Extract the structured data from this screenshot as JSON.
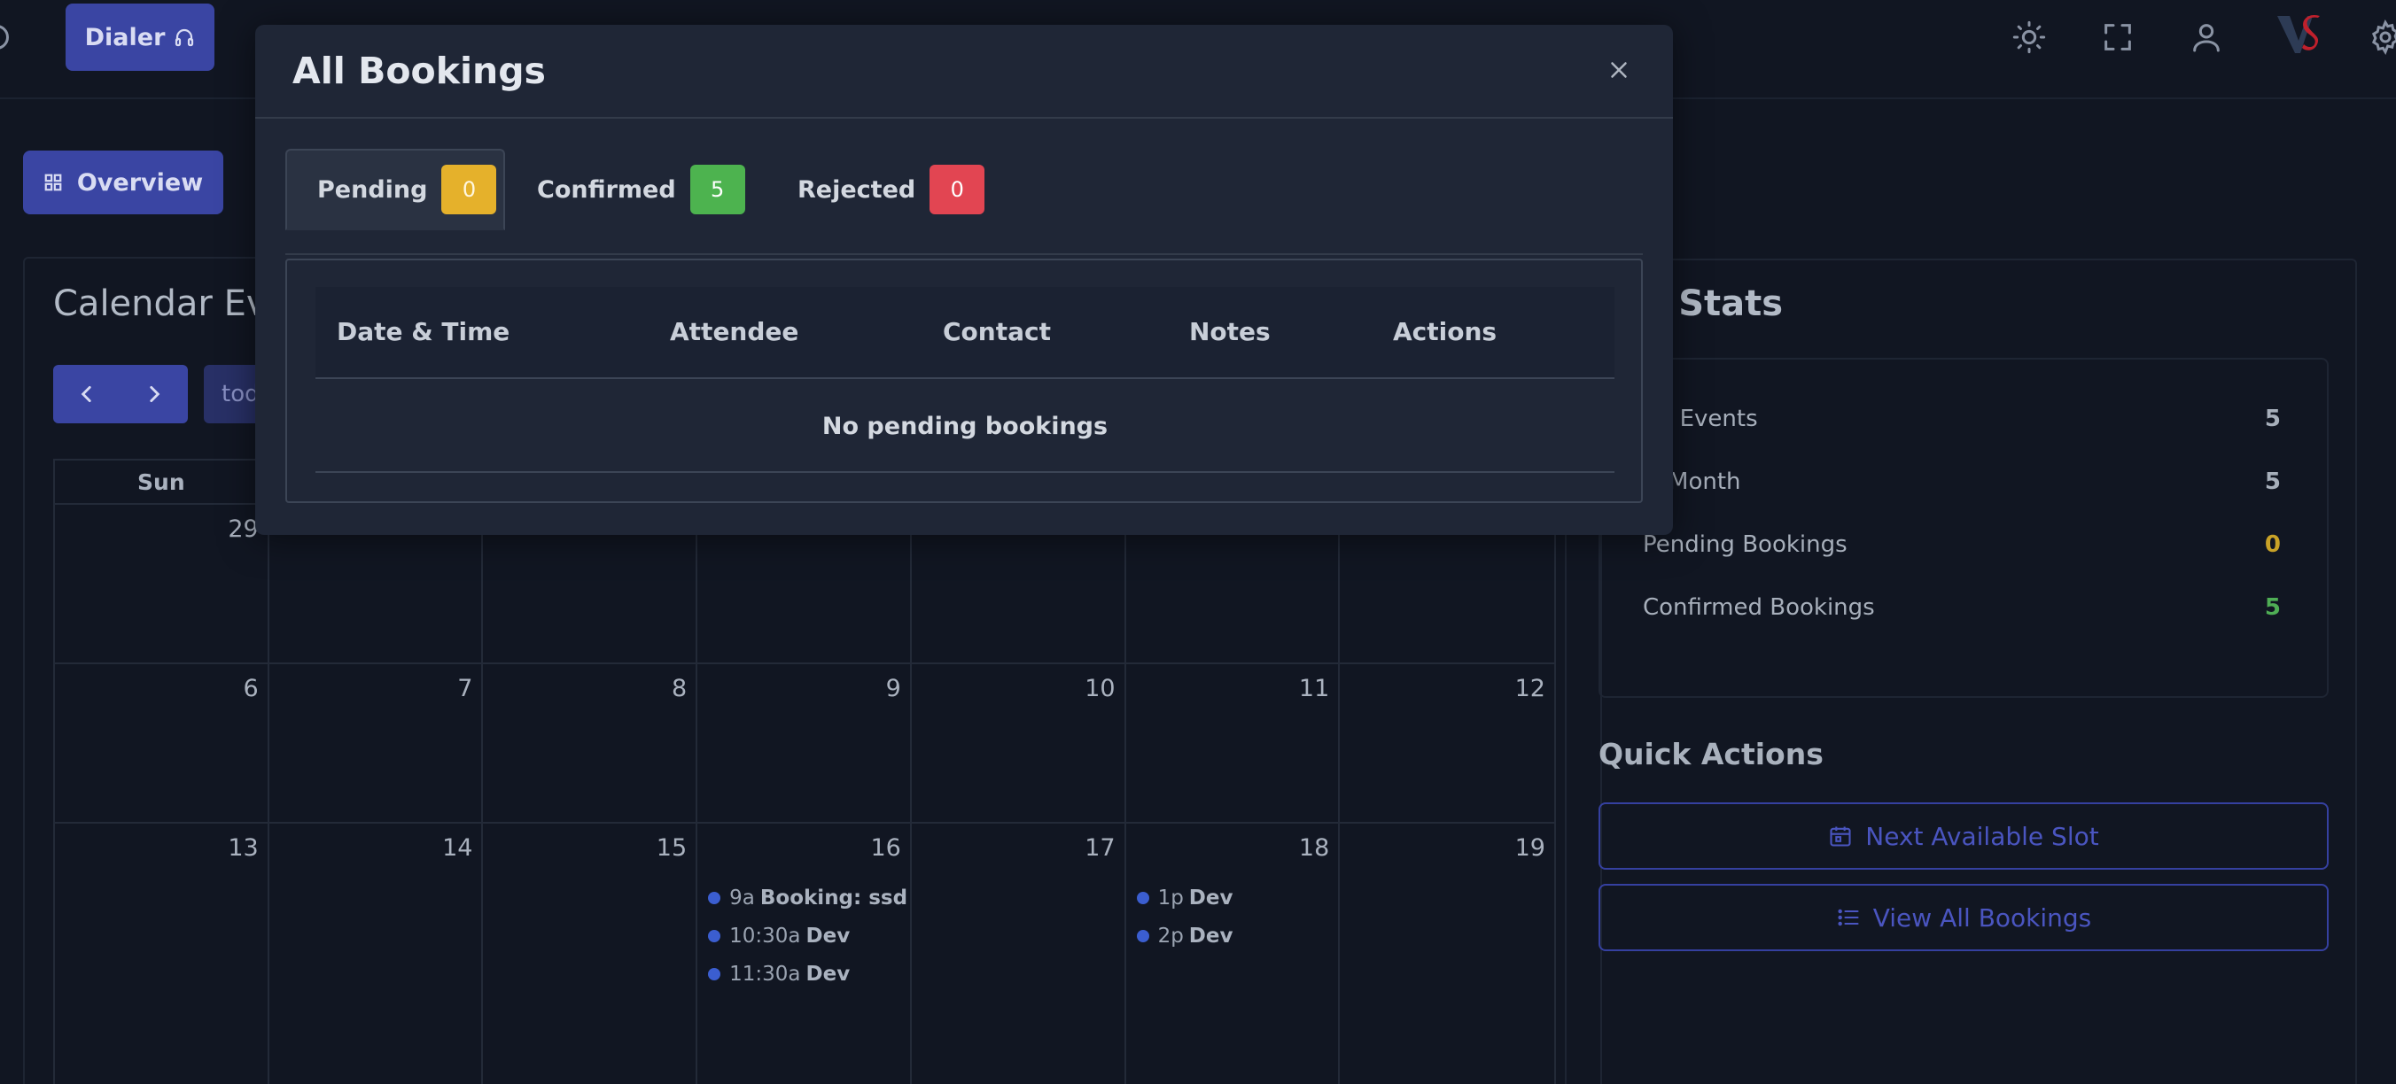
{
  "topbar": {
    "dialer_label": "Dialer",
    "icons": [
      "sun-icon",
      "fullscreen-icon",
      "user-icon",
      "brand-logo",
      "gear-icon"
    ]
  },
  "overview": {
    "label": "Overview"
  },
  "calendar": {
    "title": "Calendar Ev",
    "today_label": "tod",
    "weekday_visible": "Sun",
    "weeks": [
      [
        "29",
        "",
        "",
        "",
        "",
        "",
        ""
      ],
      [
        "6",
        "7",
        "8",
        "9",
        "10",
        "11",
        "12"
      ],
      [
        "13",
        "14",
        "15",
        "16",
        "17",
        "18",
        "19"
      ]
    ],
    "events": {
      "wed": [
        {
          "time": "9a",
          "title": "Booking: ssd"
        },
        {
          "time": "10:30a",
          "title": "Dev"
        },
        {
          "time": "11:30a",
          "title": "Dev"
        }
      ],
      "fri": [
        {
          "time": "1p",
          "title": "Dev"
        },
        {
          "time": "2p",
          "title": "Dev"
        }
      ]
    }
  },
  "stats": {
    "title": "ck Stats",
    "rows": [
      {
        "label": "tal Events",
        "value": "5",
        "color": "#a7afbb"
      },
      {
        "label": "is Month",
        "value": "5",
        "color": "#a7afbb"
      },
      {
        "label": "Pending Bookings",
        "value": "0",
        "color": "#c9a227"
      },
      {
        "label": "Confirmed Bookings",
        "value": "5",
        "color": "#4fae55"
      }
    ]
  },
  "quick_actions": {
    "title": "Quick Actions",
    "next_slot_label": "Next Available Slot",
    "view_all_label": "View All Bookings"
  },
  "modal": {
    "title": "All Bookings",
    "tabs": [
      {
        "label": "Pending",
        "count": "0",
        "color": "#e5b12b"
      },
      {
        "label": "Confirmed",
        "count": "5",
        "color": "#4db34f"
      },
      {
        "label": "Rejected",
        "count": "0",
        "color": "#e24552"
      }
    ],
    "columns": [
      "Date & Time",
      "Attendee",
      "Contact",
      "Notes",
      "Actions"
    ],
    "empty_message": "No pending bookings"
  },
  "colors": {
    "accent": "#3a45a3",
    "background": "#111622",
    "modal_bg": "#1f2636"
  }
}
